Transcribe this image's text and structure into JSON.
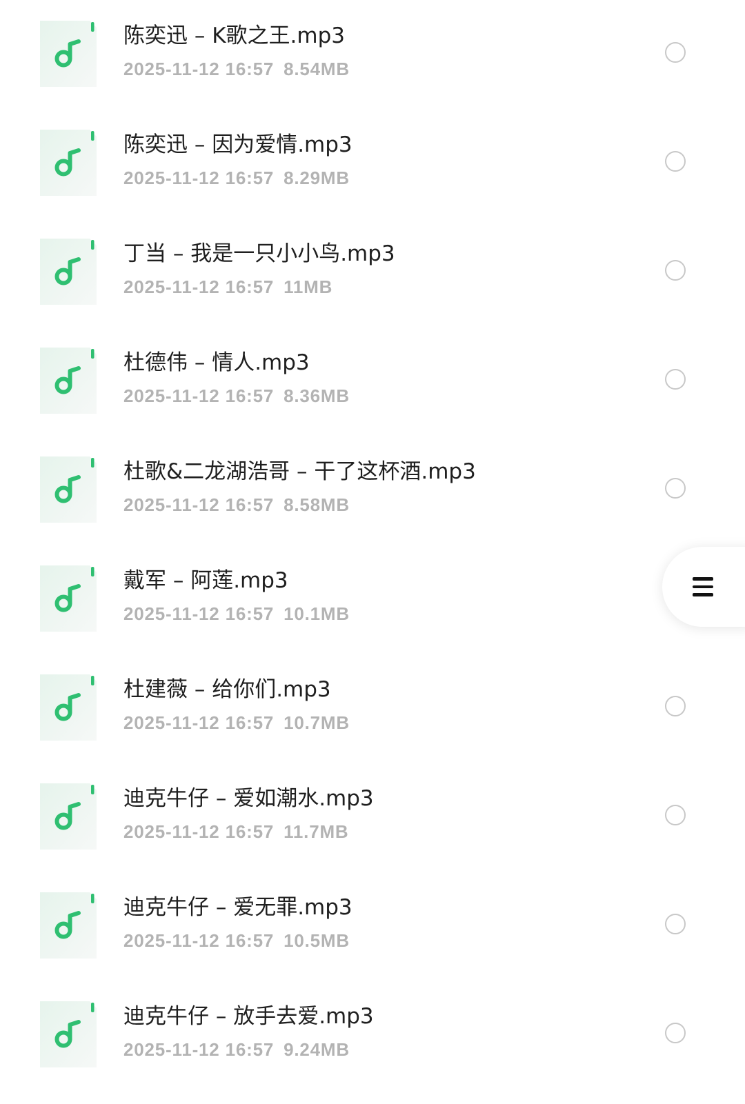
{
  "files": [
    {
      "name": "陈奕迅 – K歌之王.mp3",
      "date": "2025-11-12 16:57",
      "size": "8.54MB",
      "icon": "music-note-icon"
    },
    {
      "name": "陈奕迅 – 因为爱情.mp3",
      "date": "2025-11-12 16:57",
      "size": "8.29MB",
      "icon": "music-note-icon"
    },
    {
      "name": "丁当 – 我是一只小小鸟.mp3",
      "date": "2025-11-12 16:57",
      "size": "11MB",
      "icon": "music-note-icon"
    },
    {
      "name": "杜德伟 – 情人.mp3",
      "date": "2025-11-12 16:57",
      "size": "8.36MB",
      "icon": "music-note-icon"
    },
    {
      "name": "杜歌&二龙湖浩哥 – 干了这杯酒.mp3",
      "date": "2025-11-12 16:57",
      "size": "8.58MB",
      "icon": "music-note-icon"
    },
    {
      "name": "戴军 – 阿莲.mp3",
      "date": "2025-11-12 16:57",
      "size": "10.1MB",
      "icon": "music-note-icon"
    },
    {
      "name": "杜建薇 – 给你们.mp3",
      "date": "2025-11-12 16:57",
      "size": "10.7MB",
      "icon": "music-note-icon"
    },
    {
      "name": "迪克牛仔 – 爱如潮水.mp3",
      "date": "2025-11-12 16:57",
      "size": "11.7MB",
      "icon": "music-note-icon"
    },
    {
      "name": "迪克牛仔 – 爱无罪.mp3",
      "date": "2025-11-12 16:57",
      "size": "10.5MB",
      "icon": "music-note-icon"
    },
    {
      "name": "迪克牛仔 – 放手去爱.mp3",
      "date": "2025-11-12 16:57",
      "size": "9.24MB",
      "icon": "music-note-icon"
    }
  ],
  "floating_menu": {
    "icon": "hamburger-menu-icon"
  },
  "colors": {
    "accent_green": "#2fbf71",
    "icon_bg": "#eef7f1",
    "meta_gray": "#b3b3b3",
    "name_text": "#1f1f1f"
  }
}
